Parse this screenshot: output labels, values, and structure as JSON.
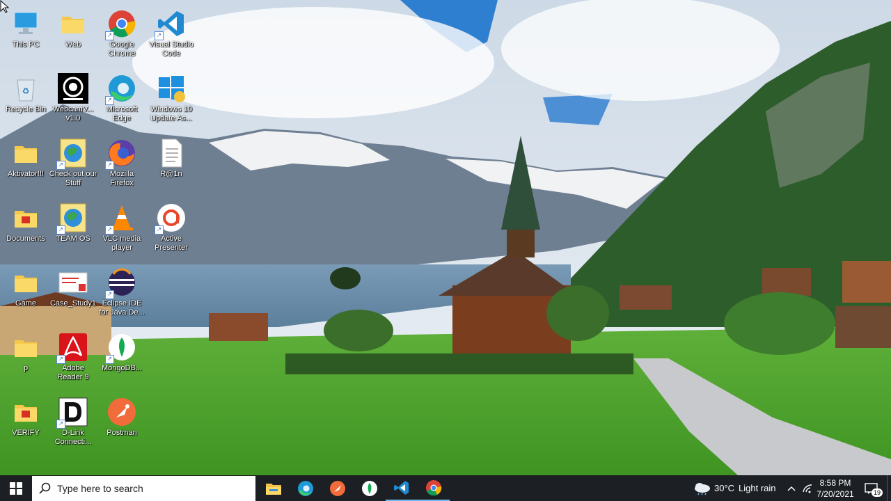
{
  "desktop": {
    "icons": [
      {
        "label": "This PC",
        "icon": "this-pc-icon"
      },
      {
        "label": "Web",
        "icon": "folder-icon"
      },
      {
        "label": "Google Chrome",
        "icon": "chrome-icon"
      },
      {
        "label": "Visual Studio Code",
        "icon": "vscode-icon"
      },
      {
        "label": "Recycle Bin",
        "icon": "recycle-bin-icon"
      },
      {
        "label": "WebcamV... v1.0",
        "icon": "webcam-icon"
      },
      {
        "label": "Microsoft Edge",
        "icon": "edge-icon"
      },
      {
        "label": "Windows 10 Update As...",
        "icon": "windows-update-icon"
      },
      {
        "label": "Aktivator!!!",
        "icon": "folder-icon"
      },
      {
        "label": "Check out our Stuff",
        "icon": "web-shortcut-icon"
      },
      {
        "label": "Mozilla Firefox",
        "icon": "firefox-icon"
      },
      {
        "label": "R@1n",
        "icon": "text-file-icon"
      },
      {
        "label": "Documents",
        "icon": "folder-icon"
      },
      {
        "label": "TEAM OS",
        "icon": "web-shortcut-icon"
      },
      {
        "label": "VLC media player",
        "icon": "vlc-icon"
      },
      {
        "label": "Active Presenter",
        "icon": "activepresenter-icon"
      },
      {
        "label": "Game",
        "icon": "folder-icon"
      },
      {
        "label": "Case_Study1",
        "icon": "document-icon"
      },
      {
        "label": "Eclipse IDE for Java De...",
        "icon": "eclipse-icon"
      },
      {
        "label": "p",
        "icon": "folder-icon"
      },
      {
        "label": "Adobe Reader 9",
        "icon": "adobe-reader-icon"
      },
      {
        "label": "MongoDB...",
        "icon": "mongodb-icon"
      },
      {
        "label": "VERIFY",
        "icon": "folder-icon"
      },
      {
        "label": "D-Link Connecti...",
        "icon": "dlink-icon"
      },
      {
        "label": "Postman",
        "icon": "postman-icon"
      }
    ]
  },
  "taskbar": {
    "start_icon": "windows-start-icon",
    "search_placeholder": "Type here to search",
    "pinned": [
      "file-explorer-icon",
      "edge-icon",
      "postman-icon",
      "mongodb-icon",
      "vscode-icon",
      "chrome-icon"
    ],
    "weather": {
      "temp": "30°C",
      "condition": "Light rain",
      "icon": "cloud-rain-icon"
    },
    "clock": {
      "time": "8:58 PM",
      "date": "7/20/2021"
    },
    "notifications": {
      "count": "19",
      "icon": "action-center-icon"
    }
  },
  "colors": {
    "taskbar": "#1c1f23",
    "search_bg": "#ffffff",
    "accent": "#0078d7"
  }
}
